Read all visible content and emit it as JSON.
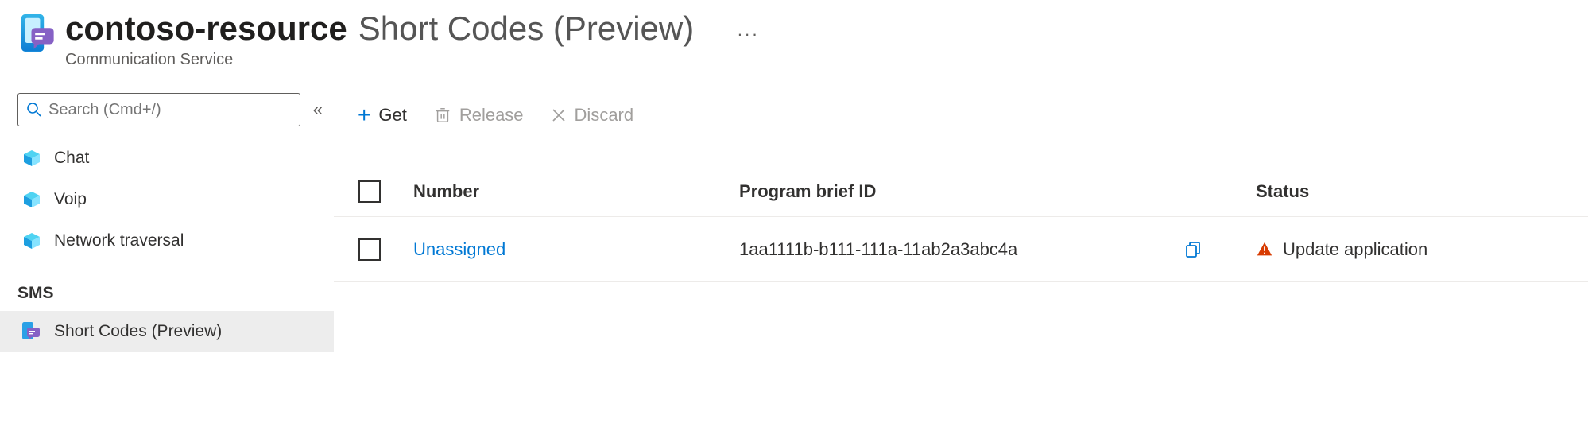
{
  "header": {
    "resource_name": "contoso-resource",
    "page_title": "Short Codes (Preview)",
    "service_type": "Communication Service",
    "more_label": "···"
  },
  "sidebar": {
    "search_placeholder": "Search (Cmd+/)",
    "items": [
      {
        "label": "Chat",
        "icon": "cube-icon"
      },
      {
        "label": "Voip",
        "icon": "cube-icon"
      },
      {
        "label": "Network traversal",
        "icon": "cube-icon"
      }
    ],
    "section_sms_label": "SMS",
    "sms_items": [
      {
        "label": "Short Codes (Preview)",
        "icon": "shortcodes-icon",
        "selected": true
      }
    ]
  },
  "toolbar": {
    "get_label": "Get",
    "release_label": "Release",
    "discard_label": "Discard"
  },
  "table": {
    "headers": {
      "number": "Number",
      "program_brief_id": "Program brief ID",
      "status": "Status"
    },
    "rows": [
      {
        "number": "Unassigned",
        "program_brief_id": "1aa1111b-b111-111a-11ab2a3abc4a",
        "status": "Update application"
      }
    ]
  }
}
